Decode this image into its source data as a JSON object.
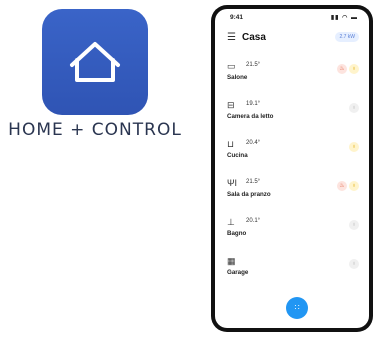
{
  "brand": {
    "app_name": "HOME + CONTROL",
    "icon": "house-outline-icon",
    "icon_bg": "#3a64c8"
  },
  "status_bar": {
    "time": "9:41",
    "system": "signal-wifi-battery"
  },
  "header": {
    "menu_icon": "hamburger-icon",
    "title": "Casa",
    "badge": "2.7 kW"
  },
  "rooms": [
    {
      "name": "Salone",
      "temp": "21.5°",
      "icon": "sofa-icon",
      "devices": [
        "heating",
        "light-on"
      ]
    },
    {
      "name": "Camera da letto",
      "temp": "19.1°",
      "icon": "bed-icon",
      "devices": [
        "light-off"
      ]
    },
    {
      "name": "Cucina",
      "temp": "20.4°",
      "icon": "pot-icon",
      "devices": [
        "light-on"
      ]
    },
    {
      "name": "Sala da pranzo",
      "temp": "21.5°",
      "icon": "cutlery-icon",
      "devices": [
        "heating",
        "light-on"
      ]
    },
    {
      "name": "Bagno",
      "temp": "20.1°",
      "icon": "bathtub-icon",
      "devices": [
        "light-off"
      ]
    },
    {
      "name": "Garage",
      "temp": "",
      "icon": "garage-icon",
      "devices": [
        "light-off"
      ]
    }
  ],
  "fab": {
    "icon": "grid-dots-icon",
    "color": "#2196f3"
  },
  "colors": {
    "heating": "#e05a3c",
    "light_on": "#e0a800",
    "light_off": "#b8b8b8"
  }
}
